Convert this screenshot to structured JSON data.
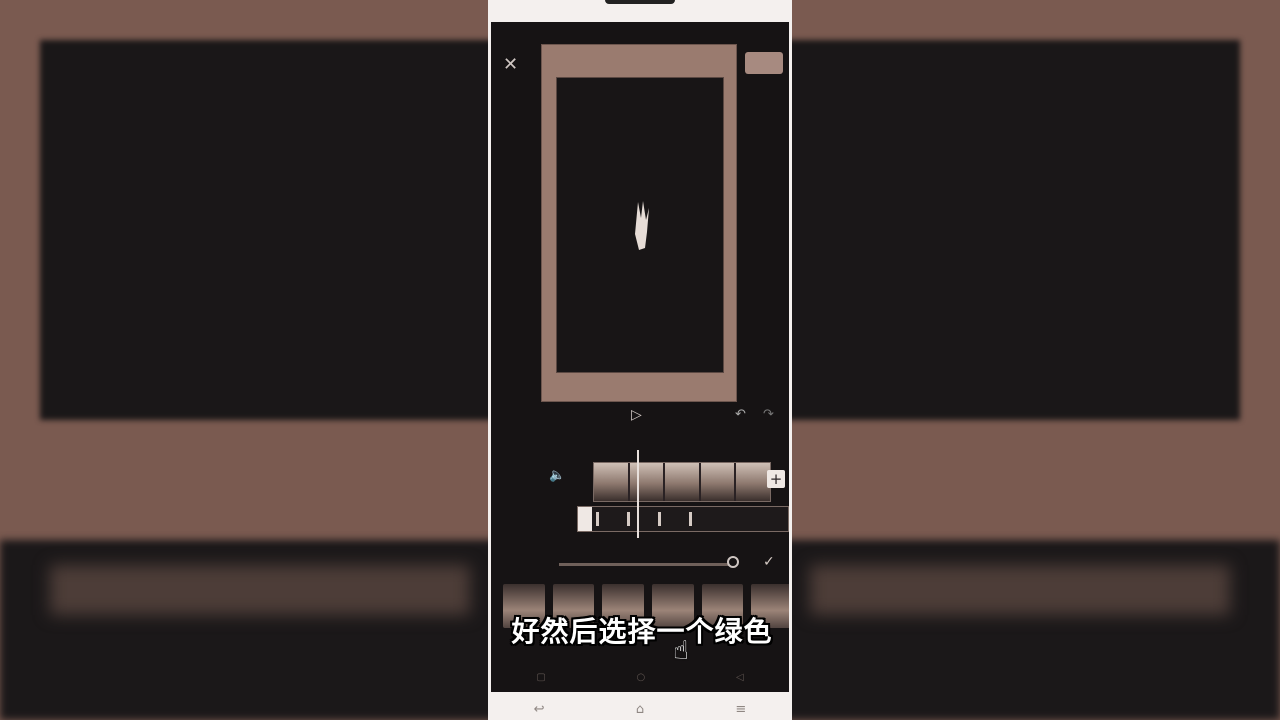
{
  "caption": "好然后选择一个绿色",
  "icons": {
    "close": "close-icon",
    "fullscreen": "fullscreen-icon",
    "play": "play-icon",
    "undo": "undo-icon",
    "redo": "redo-icon",
    "mute": "speaker-icon",
    "add": "plus-icon",
    "confirm": "check-icon",
    "pointer": "hand-pointer-icon"
  },
  "colors": {
    "background": "#1c191a",
    "frame": "#9a7b6f",
    "caption_text": "#ffffff"
  },
  "audio_wave_marks": [
    1,
    2,
    3,
    4
  ]
}
